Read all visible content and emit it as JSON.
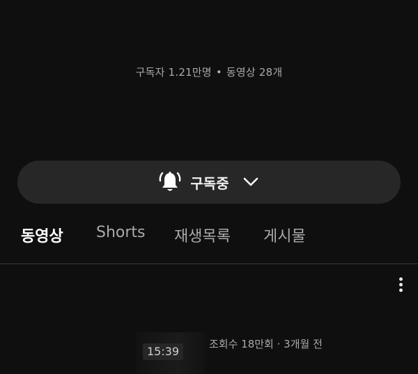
{
  "channel": {
    "subscribers": "구독자 1.21만명",
    "separator": "•",
    "video_count": "동영상 28개"
  },
  "subscribe_button": {
    "label": "구독중",
    "bell_icon": "bell-icon",
    "chevron_icon": "chevron-down-icon"
  },
  "tabs": [
    {
      "label": "동영상",
      "active": true
    },
    {
      "label": "Shorts",
      "active": false
    },
    {
      "label": "재생목록",
      "active": false
    },
    {
      "label": "게시물",
      "active": false
    }
  ],
  "video": {
    "duration": "15:39",
    "meta": "조회수 18만회 · 3개월 전",
    "more_icon": "more-vert-icon"
  }
}
